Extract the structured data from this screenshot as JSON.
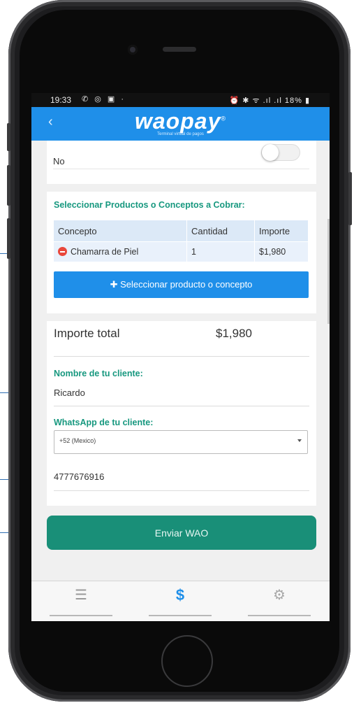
{
  "status_bar": {
    "time": "19:33",
    "left_icons": "✆ ◎ ▣ ·",
    "right_icons": "⏰ ✱ ᯤ .ıl .ıl",
    "battery": "18%"
  },
  "app_bar": {
    "back_glyph": "‹",
    "logo": "waopay",
    "logo_mark": "®",
    "tagline": "Terminal virtual de pagos"
  },
  "toggle_section": {
    "label": "No",
    "toggle_on": false
  },
  "products": {
    "title": "Seleccionar Productos o Conceptos a Cobrar:",
    "columns": [
      "Concepto",
      "Cantidad",
      "Importe"
    ],
    "rows": [
      {
        "concepto": "Chamarra de Piel",
        "cantidad": "1",
        "importe": "$1,980"
      }
    ],
    "select_button": "✚ Seleccionar producto o concepto"
  },
  "summary": {
    "total_label": "Importe total",
    "total_value": "$1,980"
  },
  "customer": {
    "name_label": "Nombre de tu cliente:",
    "name_value": "Ricardo",
    "whatsapp_label": "WhatsApp de tu cliente:",
    "country_selected": "+52 (Mexico)",
    "phone_value": "4777676916"
  },
  "send_button": "Enviar WAO",
  "tab_bar": {
    "tabs": [
      {
        "icon": "list-icon",
        "glyph": "☰"
      },
      {
        "icon": "dollar-icon",
        "glyph": "$"
      },
      {
        "icon": "gear-icon",
        "glyph": "⚙"
      }
    ]
  },
  "colors": {
    "brand_blue": "#1f8fe9",
    "accent_green": "#198f78",
    "title_green": "#17987f",
    "remove_red": "#e9473b"
  }
}
